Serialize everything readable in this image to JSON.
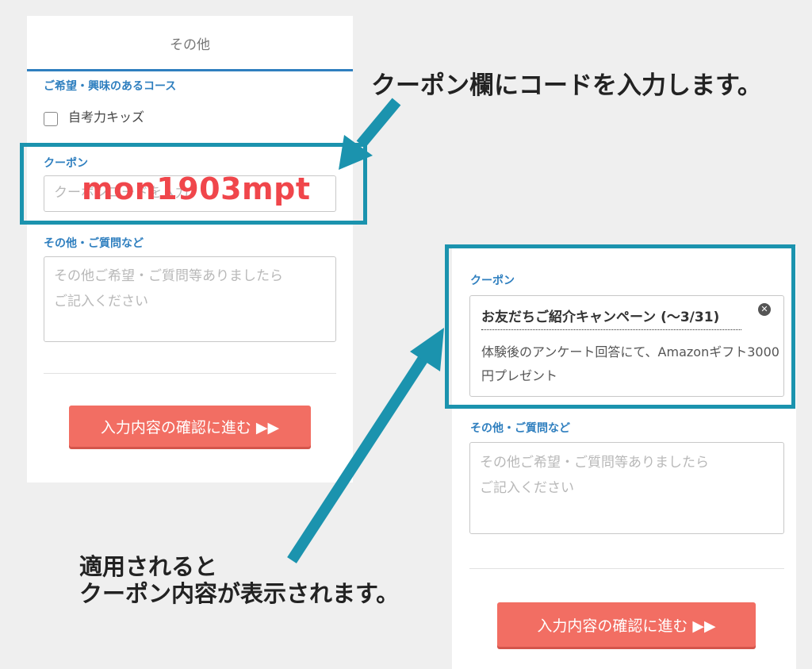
{
  "left_form": {
    "tab_label": "その他",
    "interest_label": "ご希望・興味のあるコース",
    "course_option": "自考力キッズ",
    "coupon_label": "クーポン",
    "coupon_placeholder": "クーポンコードを入力",
    "other_label": "その他・ご質問など",
    "other_placeholder_line1": "その他ご希望・ご質問等ありましたら",
    "other_placeholder_line2": "ご記入ください",
    "submit_label": "入力内容の確認に進む ▶▶"
  },
  "coupon_code_entered": "mon1903mpt",
  "callout_top": "クーポン欄にコードを入力します。",
  "callout_bottom_line1": "適用されると",
  "callout_bottom_line2": "クーポン内容が表示されます。",
  "right_form": {
    "coupon_label": "クーポン",
    "coupon_title": "お友だちご紹介キャンペーン (〜3/31)",
    "coupon_description": "体験後のアンケート回答にて、Amazonギフト3000円プレゼント",
    "other_label": "その他・ご質問など",
    "other_placeholder_line1": "その他ご希望・ご質問等ありましたら",
    "other_placeholder_line2": "ご記入ください",
    "submit_label": "入力内容の確認に進む ▶▶"
  },
  "colors": {
    "accent_blue": "#2f7fbf",
    "highlight_teal": "#1b93ae",
    "submit_red": "#f26e63",
    "code_red": "#f0464b"
  }
}
